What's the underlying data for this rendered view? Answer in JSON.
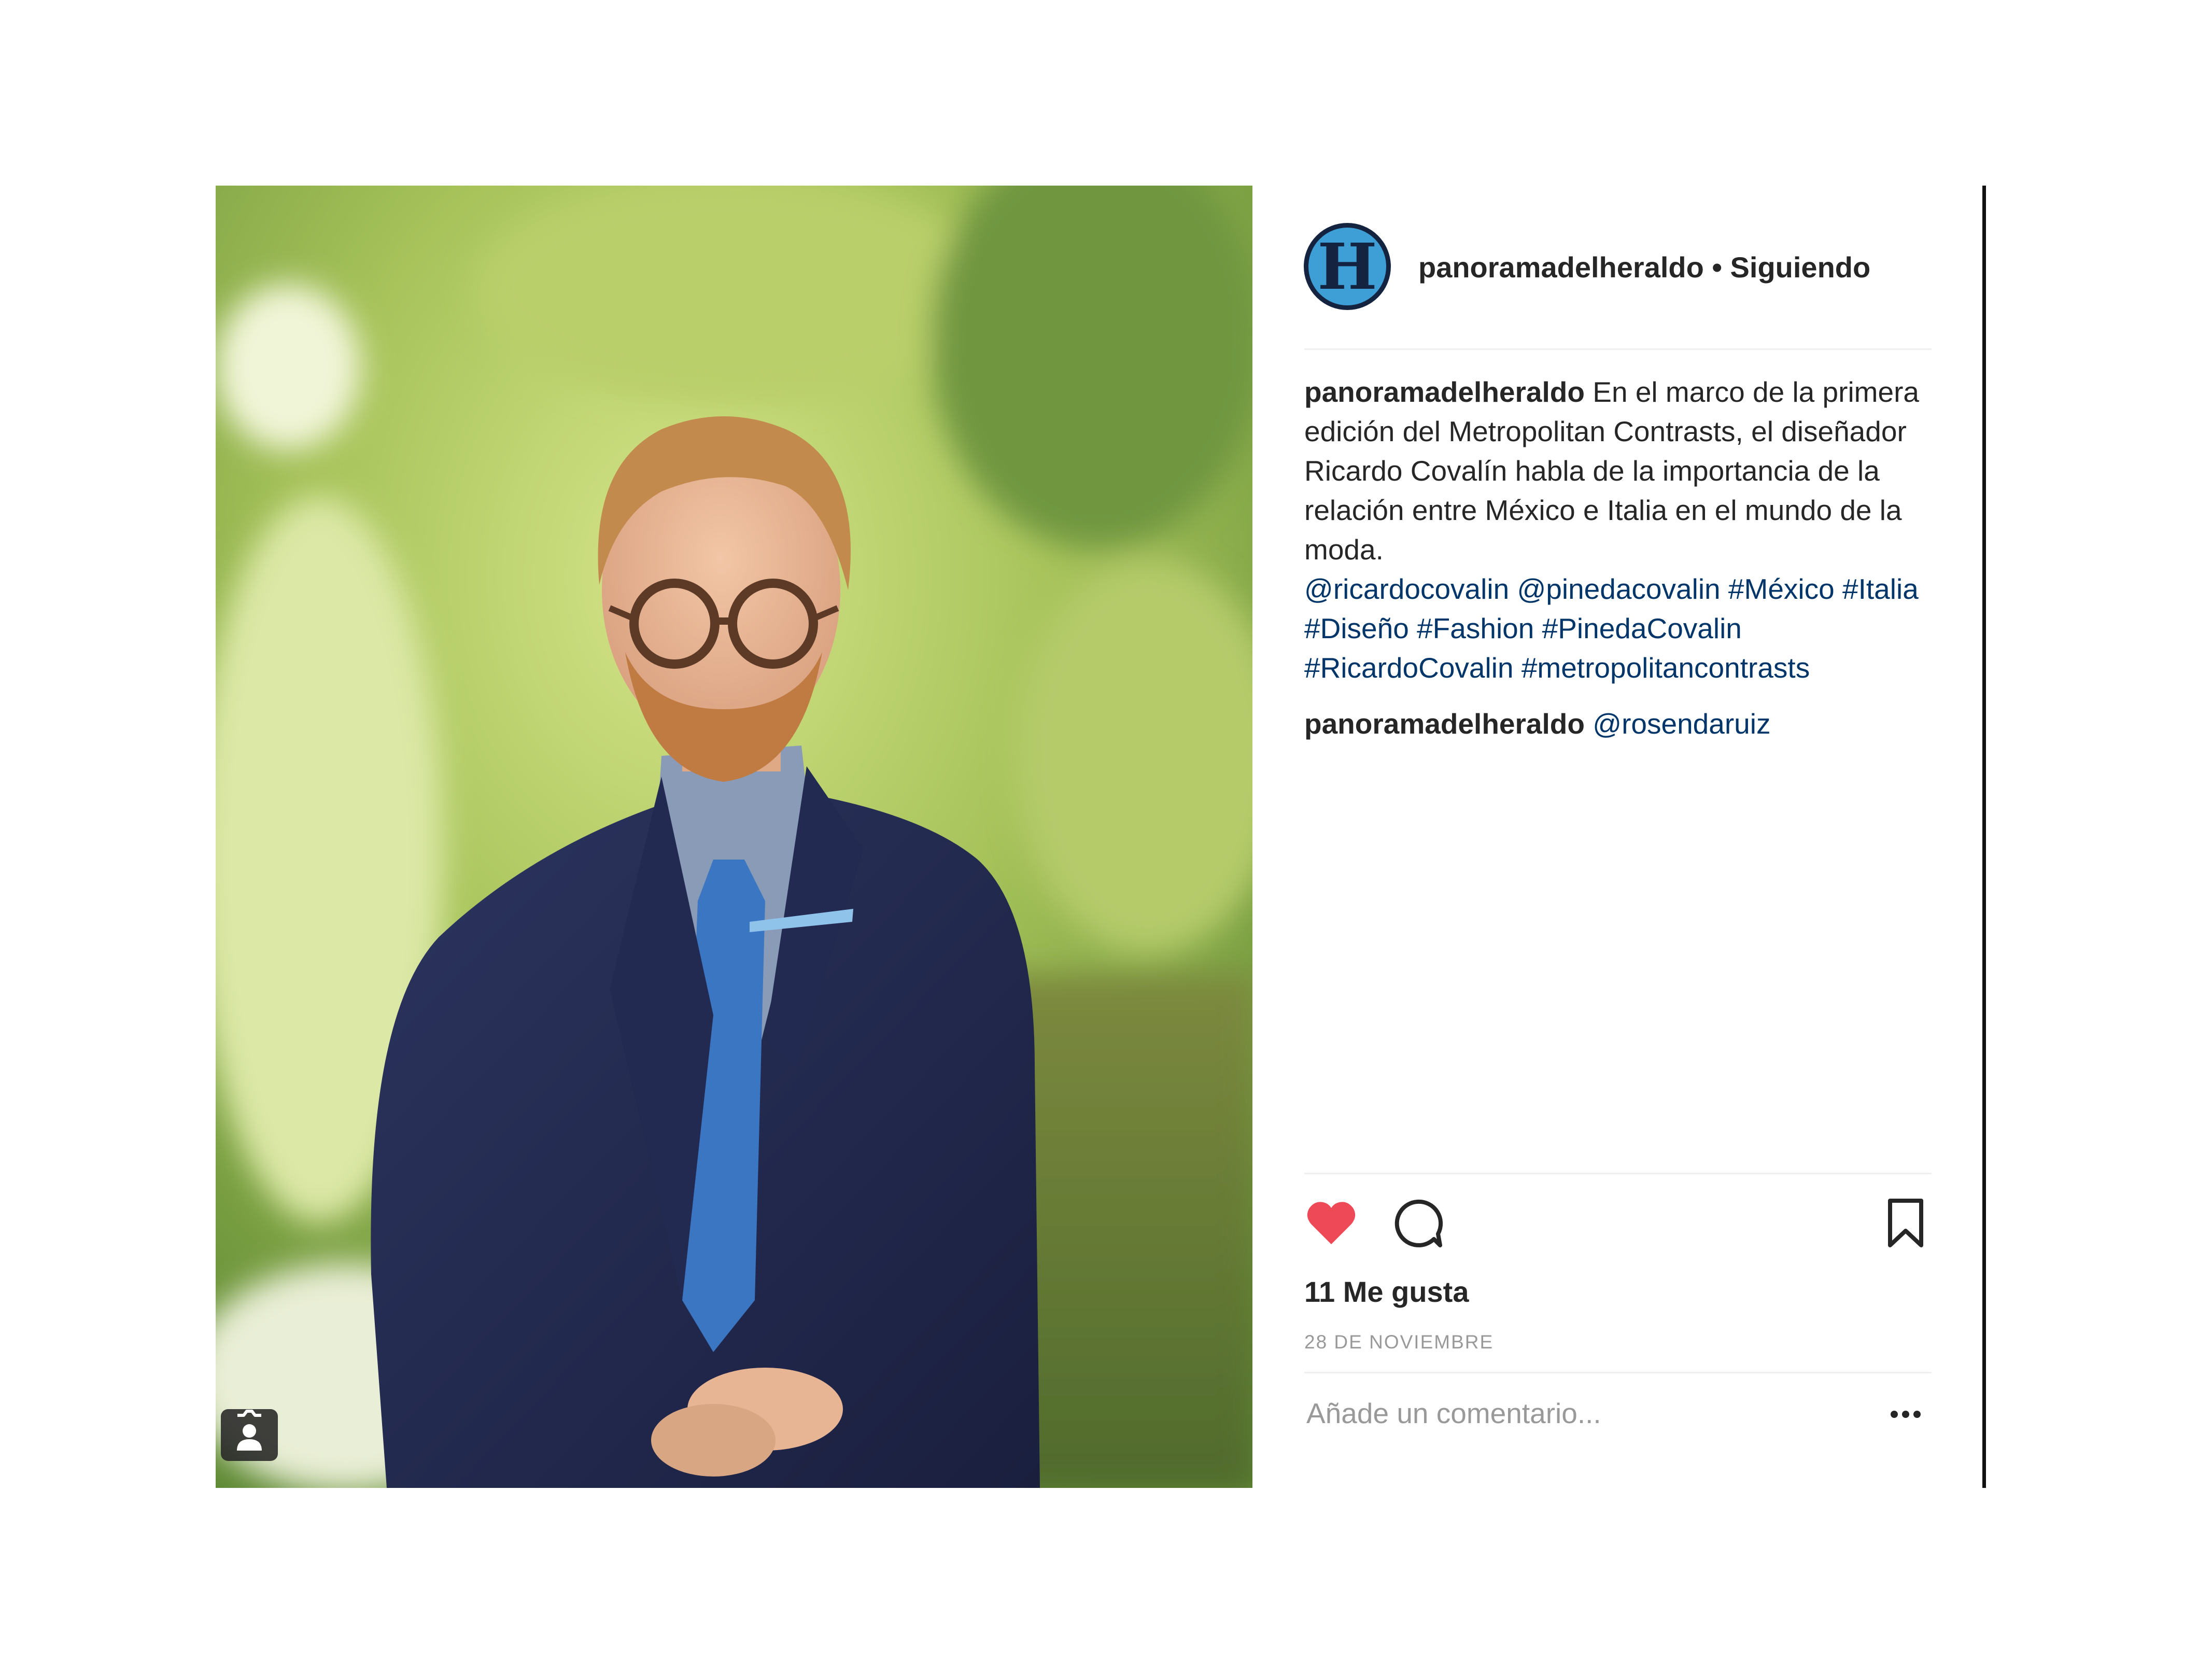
{
  "colors": {
    "text": "#262626",
    "link": "#003569",
    "muted": "#999999",
    "divider": "#efefef",
    "heart": "#ed4956",
    "avatar_blue": "#3e9fd6",
    "avatar_navy": "#14233f"
  },
  "post": {
    "photo": {
      "alt_icon": "user-tag-icon"
    },
    "header": {
      "avatar_letter": "H",
      "username": "panoramadelheraldo",
      "separator": "•",
      "follow_status": "Siguiendo"
    },
    "caption": {
      "username": "panoramadelheraldo",
      "text": "En el marco de la primera edición del Metropolitan Contrasts, el diseñador Ricardo Covalín habla de la importancia de la relación entre México e Italia en el mundo de la moda.",
      "tags": [
        "@ricardocovalin",
        "@pinedacovalin",
        "#México",
        "#Italia",
        "#Diseño",
        "#Fashion",
        "#PinedaCovalin",
        "#RicardoCovalin",
        "#metropolitancontrasts"
      ]
    },
    "comments": [
      {
        "username": "panoramadelheraldo",
        "text": "@rosendaruiz"
      }
    ],
    "actions": {
      "like_icon": "heart-filled-icon",
      "comment_icon": "comment-bubble-icon",
      "save_icon": "bookmark-icon",
      "liked": true
    },
    "likes_text": "11 Me gusta",
    "date": "28 DE NOVIEMBRE",
    "comment_input": {
      "placeholder": "Añade un comentario...",
      "value": ""
    },
    "more_icon": "more-options-icon"
  }
}
